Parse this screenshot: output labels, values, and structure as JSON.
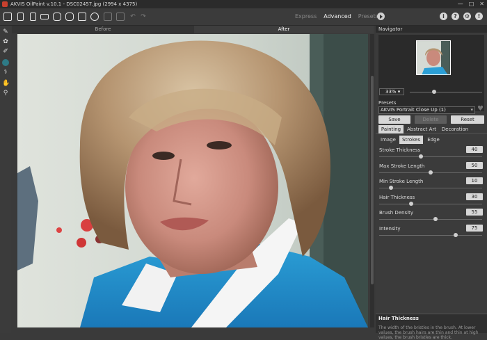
{
  "window": {
    "title": "AKVIS OilPaint v.10.1 - DSC02457.jpg (2994 x 4375)",
    "controls": [
      "—",
      "□",
      "✕"
    ]
  },
  "toolbar": {
    "mode_tabs": [
      "Express",
      "Advanced",
      "Presets"
    ],
    "active_mode": "Advanced",
    "right_icons": [
      "i",
      "?",
      "⚙",
      "!"
    ]
  },
  "canvas": {
    "before_label": "Before",
    "after_label": "After"
  },
  "navigator": {
    "title": "Navigator",
    "zoom": "33%"
  },
  "presets": {
    "label": "Presets",
    "selected": "AKVIS Portrait Close Up (1)",
    "save_label": "Save",
    "delete_label": "Delete",
    "reset_label": "Reset"
  },
  "main_tabs": [
    "Painting",
    "Abstract Art",
    "Decoration"
  ],
  "sub_tabs": [
    "Image",
    "Strokes",
    "Edge"
  ],
  "parameters": [
    {
      "label": "Stroke Thickness",
      "value": "40",
      "fraction": 0.4
    },
    {
      "label": "Max Stroke Length",
      "value": "50",
      "fraction": 0.5
    },
    {
      "label": "Min Stroke Length",
      "value": "10",
      "fraction": 0.1
    },
    {
      "label": "Hair Thickness",
      "value": "30",
      "fraction": 0.3
    },
    {
      "label": "Brush Density",
      "value": "55",
      "fraction": 0.55
    },
    {
      "label": "Intensity",
      "value": "75",
      "fraction": 0.75
    }
  ],
  "help": {
    "title": "Hair Thickness",
    "text": "The width of the bristles in the brush. At lower values, the brush hairs are thin and thin at high values, the brush bristles are thick."
  },
  "colors": {
    "accent": "#2e7a86",
    "panel_bg": "#3b3b3b",
    "titlebar_bg": "#2b2b2b"
  }
}
